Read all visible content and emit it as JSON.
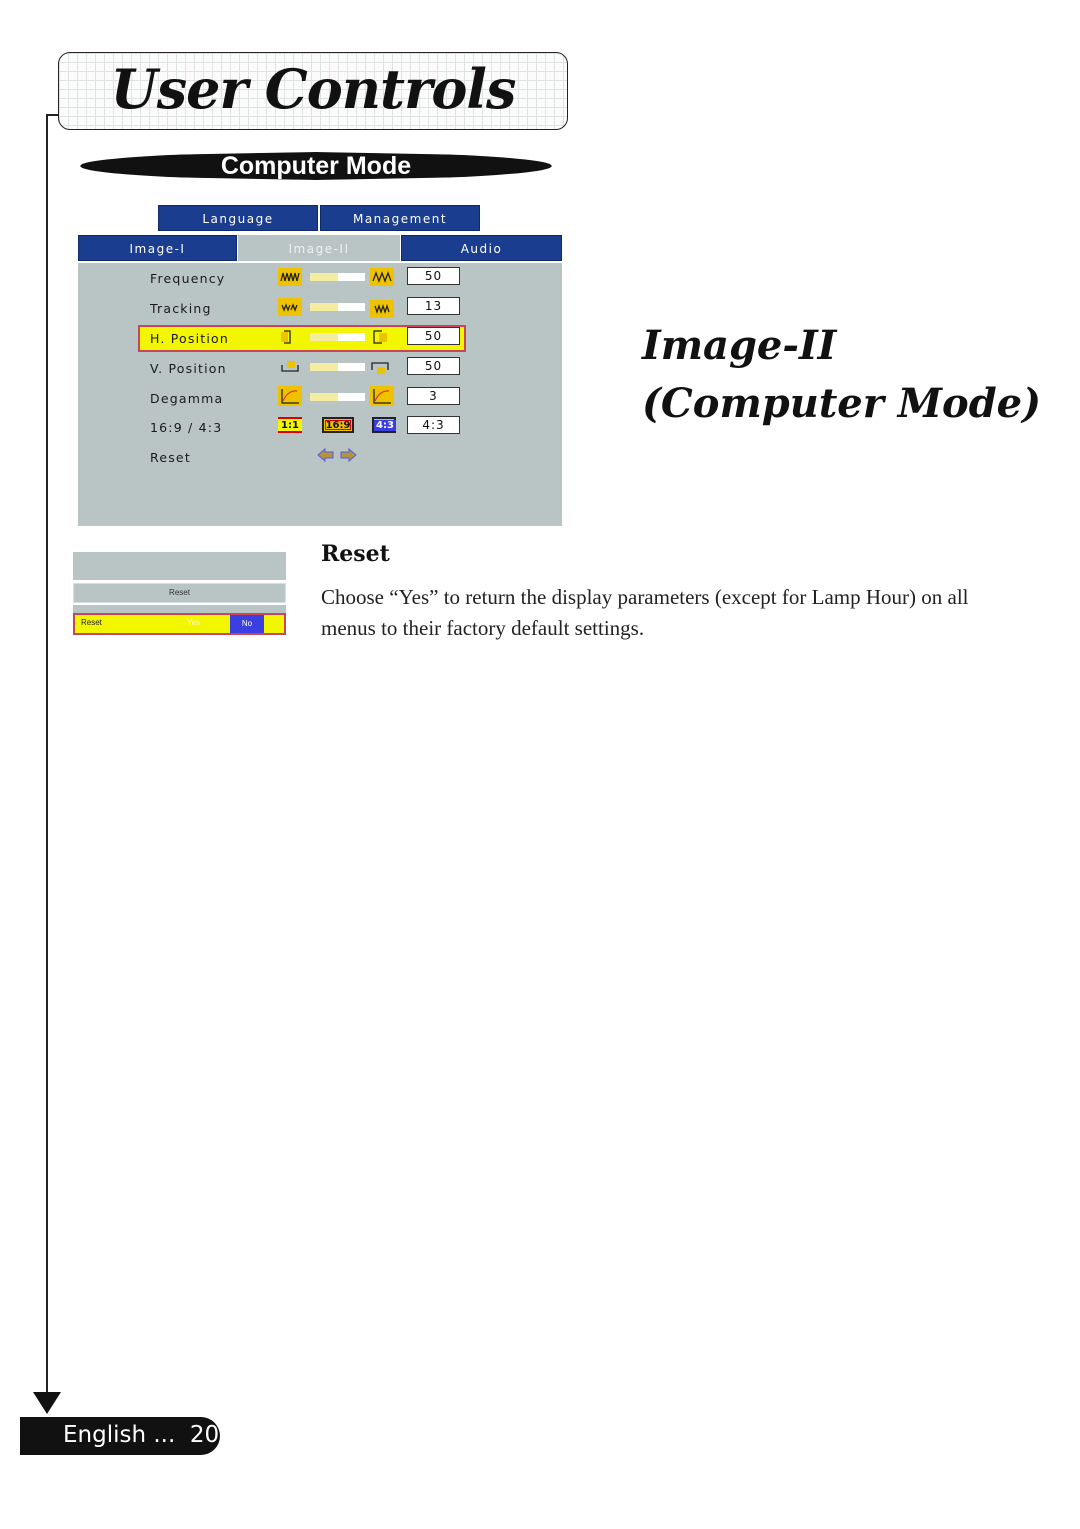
{
  "header": {
    "title": "User Controls",
    "banner": "Computer Mode"
  },
  "osd": {
    "top_tabs": [
      {
        "label": "Language"
      },
      {
        "label": "Management"
      }
    ],
    "tabs": [
      {
        "label": "Image-I",
        "active": false
      },
      {
        "label": "Image-II",
        "active": true
      },
      {
        "label": "Audio",
        "active": false
      }
    ],
    "rows": [
      {
        "label": "Frequency",
        "left_icon": "frequency-low-icon",
        "right_icon": "frequency-high-icon",
        "slider_fraction": 0.5,
        "value": "50",
        "selected": false
      },
      {
        "label": "Tracking",
        "left_icon": "tracking-low-icon",
        "right_icon": "tracking-high-icon",
        "slider_fraction": 0.5,
        "value": "13",
        "selected": false
      },
      {
        "label": "H. Position",
        "left_icon": "h-position-left-icon",
        "right_icon": "h-position-right-icon",
        "slider_fraction": 0.5,
        "value": "50",
        "selected": true
      },
      {
        "label": "V. Position",
        "left_icon": "v-position-up-icon",
        "right_icon": "v-position-down-icon",
        "slider_fraction": 0.5,
        "value": "50",
        "selected": false
      },
      {
        "label": "Degamma",
        "left_icon": "degamma-curve-icon",
        "right_icon": "degamma-curve-icon",
        "slider_fraction": 0.5,
        "value": "3",
        "selected": false
      },
      {
        "label": "16:9 / 4:3",
        "options": [
          "1:1",
          "16:9",
          "4:3"
        ],
        "value": "4:3",
        "selected": false
      },
      {
        "label": "Reset",
        "icon": "left-right-arrows-icon",
        "selected": false
      }
    ]
  },
  "reset_dialog": {
    "title": "Reset",
    "row_label": "Reset",
    "yes_label": "Yes",
    "no_label": "No",
    "selected": "No"
  },
  "content": {
    "section_title": "Image-II",
    "section_subtitle": "(Computer Mode)",
    "reset_heading": "Reset",
    "reset_description": "Choose “Yes” to return the display parameters (except for Lamp Hour) on all menus to their factory default settings."
  },
  "footer": {
    "language": "English ...",
    "page_number": "20",
    "text": "English ...  20"
  }
}
